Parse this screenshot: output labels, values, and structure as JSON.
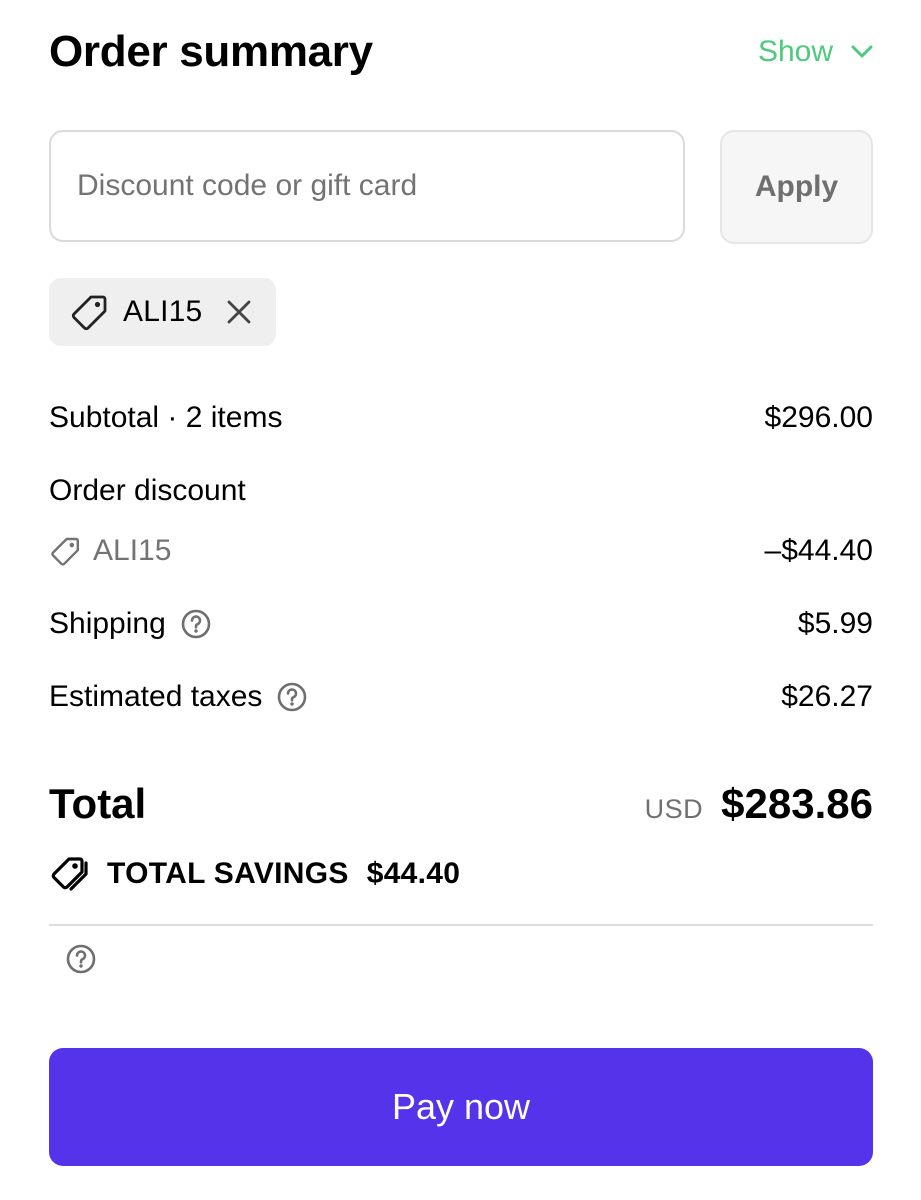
{
  "header": {
    "title": "Order summary",
    "toggle_label": "Show",
    "toggle_icon": "chevron-down-icon",
    "accent_color": "#4fc97e"
  },
  "discount": {
    "placeholder": "Discount code or gift card",
    "value": "",
    "apply_label": "Apply",
    "applied_code": "ALI15",
    "applied_icon": "tag-icon",
    "remove_icon": "close-icon"
  },
  "summary": {
    "subtotal_label": "Subtotal · 2 items",
    "subtotal_value": "$296.00",
    "order_discount_label": "Order discount",
    "discount_code": "ALI15",
    "discount_value": "–$44.40",
    "shipping_label": "Shipping",
    "shipping_value": "$5.99",
    "taxes_label": "Estimated taxes",
    "taxes_value": "$26.27",
    "help_icon": "help-circle-icon"
  },
  "total": {
    "label": "Total",
    "currency": "USD",
    "amount": "$283.86"
  },
  "savings": {
    "icon": "tags-icon",
    "label": "TOTAL SAVINGS",
    "amount": "$44.40"
  },
  "pay": {
    "label": "Pay now",
    "color": "#5433eb"
  }
}
